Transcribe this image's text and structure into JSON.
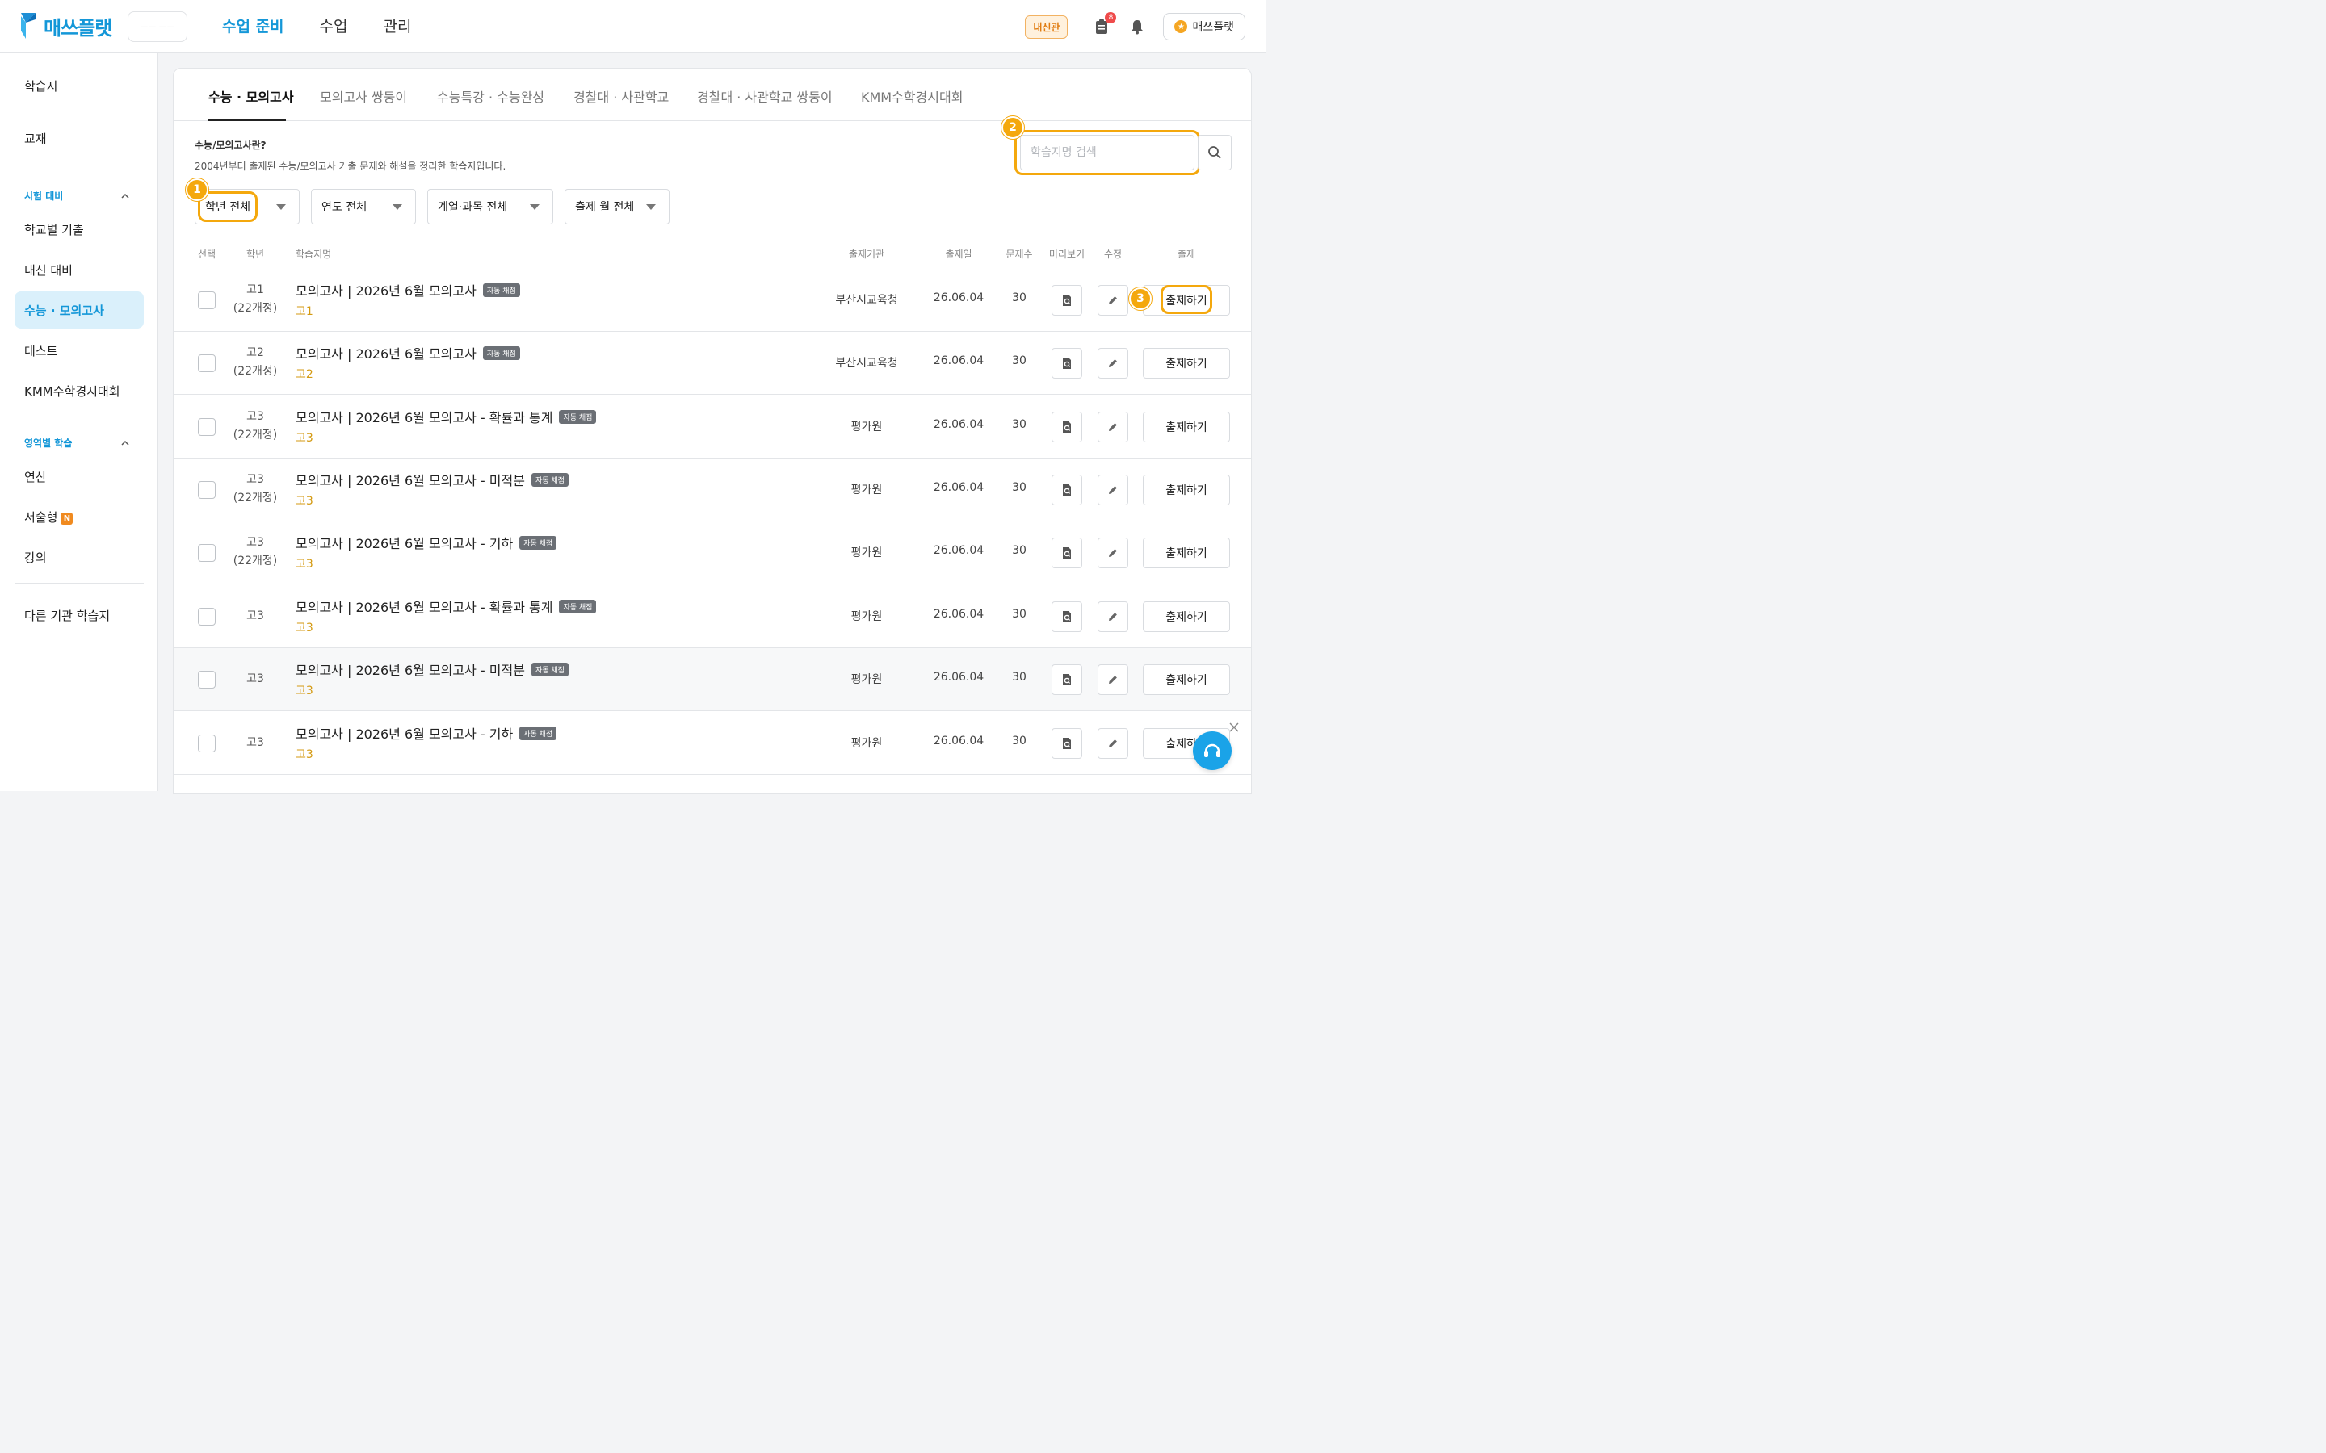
{
  "brand": {
    "name": "매쓰플랫",
    "academy_placeholder": "—— ——"
  },
  "top_nav": [
    {
      "label": "수업 준비",
      "active": true
    },
    {
      "label": "수업",
      "active": false
    },
    {
      "label": "관리",
      "active": false
    }
  ],
  "header_right": {
    "naesin_badge": "내신관",
    "notification_count": "8",
    "profile_label": "매쓰플랫"
  },
  "sidebar": {
    "item_worksheet": "학습지",
    "item_textbook": "교재",
    "section_exam": "시험 대비",
    "item_school_past": "학교별 기출",
    "item_naesin": "내신 대비",
    "item_suneung": "수능 · 모의고사",
    "item_test": "테스트",
    "item_kmm": "KMM수학경시대회",
    "section_area": "영역별 학습",
    "item_calc": "연산",
    "item_essay": "서술형",
    "new_badge": "N",
    "item_lecture": "강의",
    "item_other": "다른 기관 학습지"
  },
  "tabs": [
    {
      "label": "수능 · 모의고사",
      "active": true
    },
    {
      "label": "모의고사 쌍둥이",
      "active": false
    },
    {
      "label": "수능특강 · 수능완성",
      "active": false
    },
    {
      "label": "경찰대 · 사관학교",
      "active": false
    },
    {
      "label": "경찰대 · 사관학교 쌍둥이",
      "active": false
    },
    {
      "label": "KMM수학경시대회",
      "active": false
    }
  ],
  "info": {
    "title": "수능/모의고사란?",
    "description": "2004년부터 출제된 수능/모의고사 기출 문제와 해설을 정리한 학습지입니다."
  },
  "search": {
    "placeholder": "학습지명 검색",
    "value": ""
  },
  "filters": [
    "학년 전체",
    "연도 전체",
    "계열·과목 전체",
    "출제 월 전체"
  ],
  "steps": [
    "1",
    "2",
    "3"
  ],
  "table": {
    "headers": {
      "select": "선택",
      "grade": "학년",
      "name": "학습지명",
      "org": "출제기관",
      "date": "출제일",
      "count": "문제수",
      "preview": "미리보기",
      "edit": "수정",
      "assign": "출제"
    },
    "auto_badge": "자동 채점",
    "assign_label": "출제하기",
    "rows": [
      {
        "grade_line1": "고1",
        "grade_line2": "(22개정)",
        "title": "모의고사 | 2026년 6월 모의고사",
        "sub": "고1",
        "org": "부산시교육청",
        "date": "26.06.04",
        "count": "30"
      },
      {
        "grade_line1": "고2",
        "grade_line2": "(22개정)",
        "title": "모의고사 | 2026년 6월 모의고사",
        "sub": "고2",
        "org": "부산시교육청",
        "date": "26.06.04",
        "count": "30"
      },
      {
        "grade_line1": "고3",
        "grade_line2": "(22개정)",
        "title": "모의고사 | 2026년 6월 모의고사 - 확률과 통계",
        "sub": "고3",
        "org": "평가원",
        "date": "26.06.04",
        "count": "30"
      },
      {
        "grade_line1": "고3",
        "grade_line2": "(22개정)",
        "title": "모의고사 | 2026년 6월 모의고사 - 미적분",
        "sub": "고3",
        "org": "평가원",
        "date": "26.06.04",
        "count": "30"
      },
      {
        "grade_line1": "고3",
        "grade_line2": "(22개정)",
        "title": "모의고사 | 2026년 6월 모의고사 - 기하",
        "sub": "고3",
        "org": "평가원",
        "date": "26.06.04",
        "count": "30"
      },
      {
        "grade_line1": "고3",
        "grade_line2": "",
        "title": "모의고사 | 2026년 6월 모의고사 - 확률과 통계",
        "sub": "고3",
        "org": "평가원",
        "date": "26.06.04",
        "count": "30"
      },
      {
        "grade_line1": "고3",
        "grade_line2": "",
        "title": "모의고사 | 2026년 6월 모의고사 - 미적분",
        "sub": "고3",
        "org": "평가원",
        "date": "26.06.04",
        "count": "30"
      },
      {
        "grade_line1": "고3",
        "grade_line2": "",
        "title": "모의고사 | 2026년 6월 모의고사 - 기하",
        "sub": "고3",
        "org": "평가원",
        "date": "26.06.04",
        "count": "30"
      }
    ]
  },
  "colors": {
    "brand": "#1497d8",
    "highlight": "#f4a80d",
    "sub_grade": "#d49a12"
  }
}
